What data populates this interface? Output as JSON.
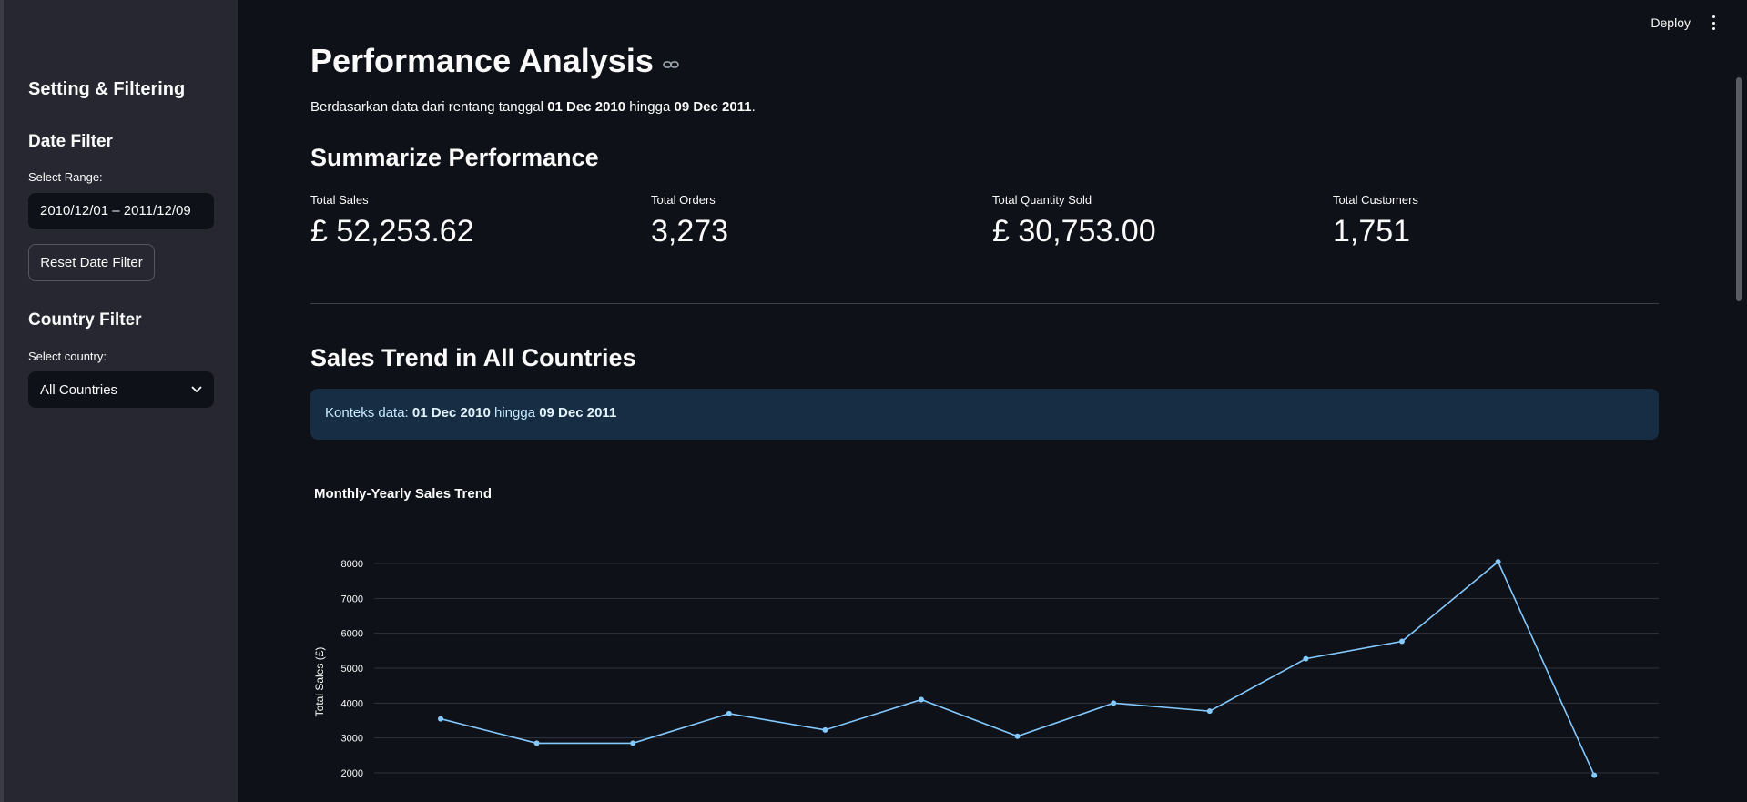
{
  "topbar": {
    "deploy_label": "Deploy",
    "menu_icon": "kebab-menu-icon"
  },
  "sidebar": {
    "title": "Setting & Filtering",
    "date_filter": {
      "heading": "Date Filter",
      "label": "Select Range:",
      "value": "2010/12/01 – 2011/12/09",
      "reset_label": "Reset Date Filter"
    },
    "country_filter": {
      "heading": "Country Filter",
      "label": "Select country:",
      "value": "All Countries"
    }
  },
  "main": {
    "title": "Performance Analysis",
    "subtitle": {
      "prefix": "Berdasarkan data dari rentang tanggal ",
      "start": "01 Dec 2010",
      "middle": " hingga ",
      "end": "09 Dec 2011",
      "suffix": "."
    },
    "summary_heading": "Summarize Performance",
    "metrics": [
      {
        "label": "Total Sales",
        "value": "£ 52,253.62"
      },
      {
        "label": "Total Orders",
        "value": "3,273"
      },
      {
        "label": "Total Quantity Sold",
        "value": "£ 30,753.00"
      },
      {
        "label": "Total Customers",
        "value": "1,751"
      }
    ],
    "trend_heading": "Sales Trend in All Countries",
    "info": {
      "prefix": "Konteks data: ",
      "start": "01 Dec 2010",
      "middle": " hingga ",
      "end": "09 Dec 2011"
    }
  },
  "chart_data": {
    "type": "line",
    "title": "Monthly-Yearly Sales Trend",
    "xlabel": "",
    "ylabel": "Total Sales (£)",
    "ylim": [
      2000,
      8000
    ],
    "yticks": [
      2000,
      3000,
      4000,
      5000,
      6000,
      7000,
      8000
    ],
    "grid": true,
    "line_color": "#83c9ff",
    "series": [
      {
        "values": [
          3550,
          2850,
          2850,
          3700,
          3230,
          4100,
          3050,
          4000,
          3770,
          5270,
          5770,
          8050,
          1930
        ]
      }
    ]
  }
}
